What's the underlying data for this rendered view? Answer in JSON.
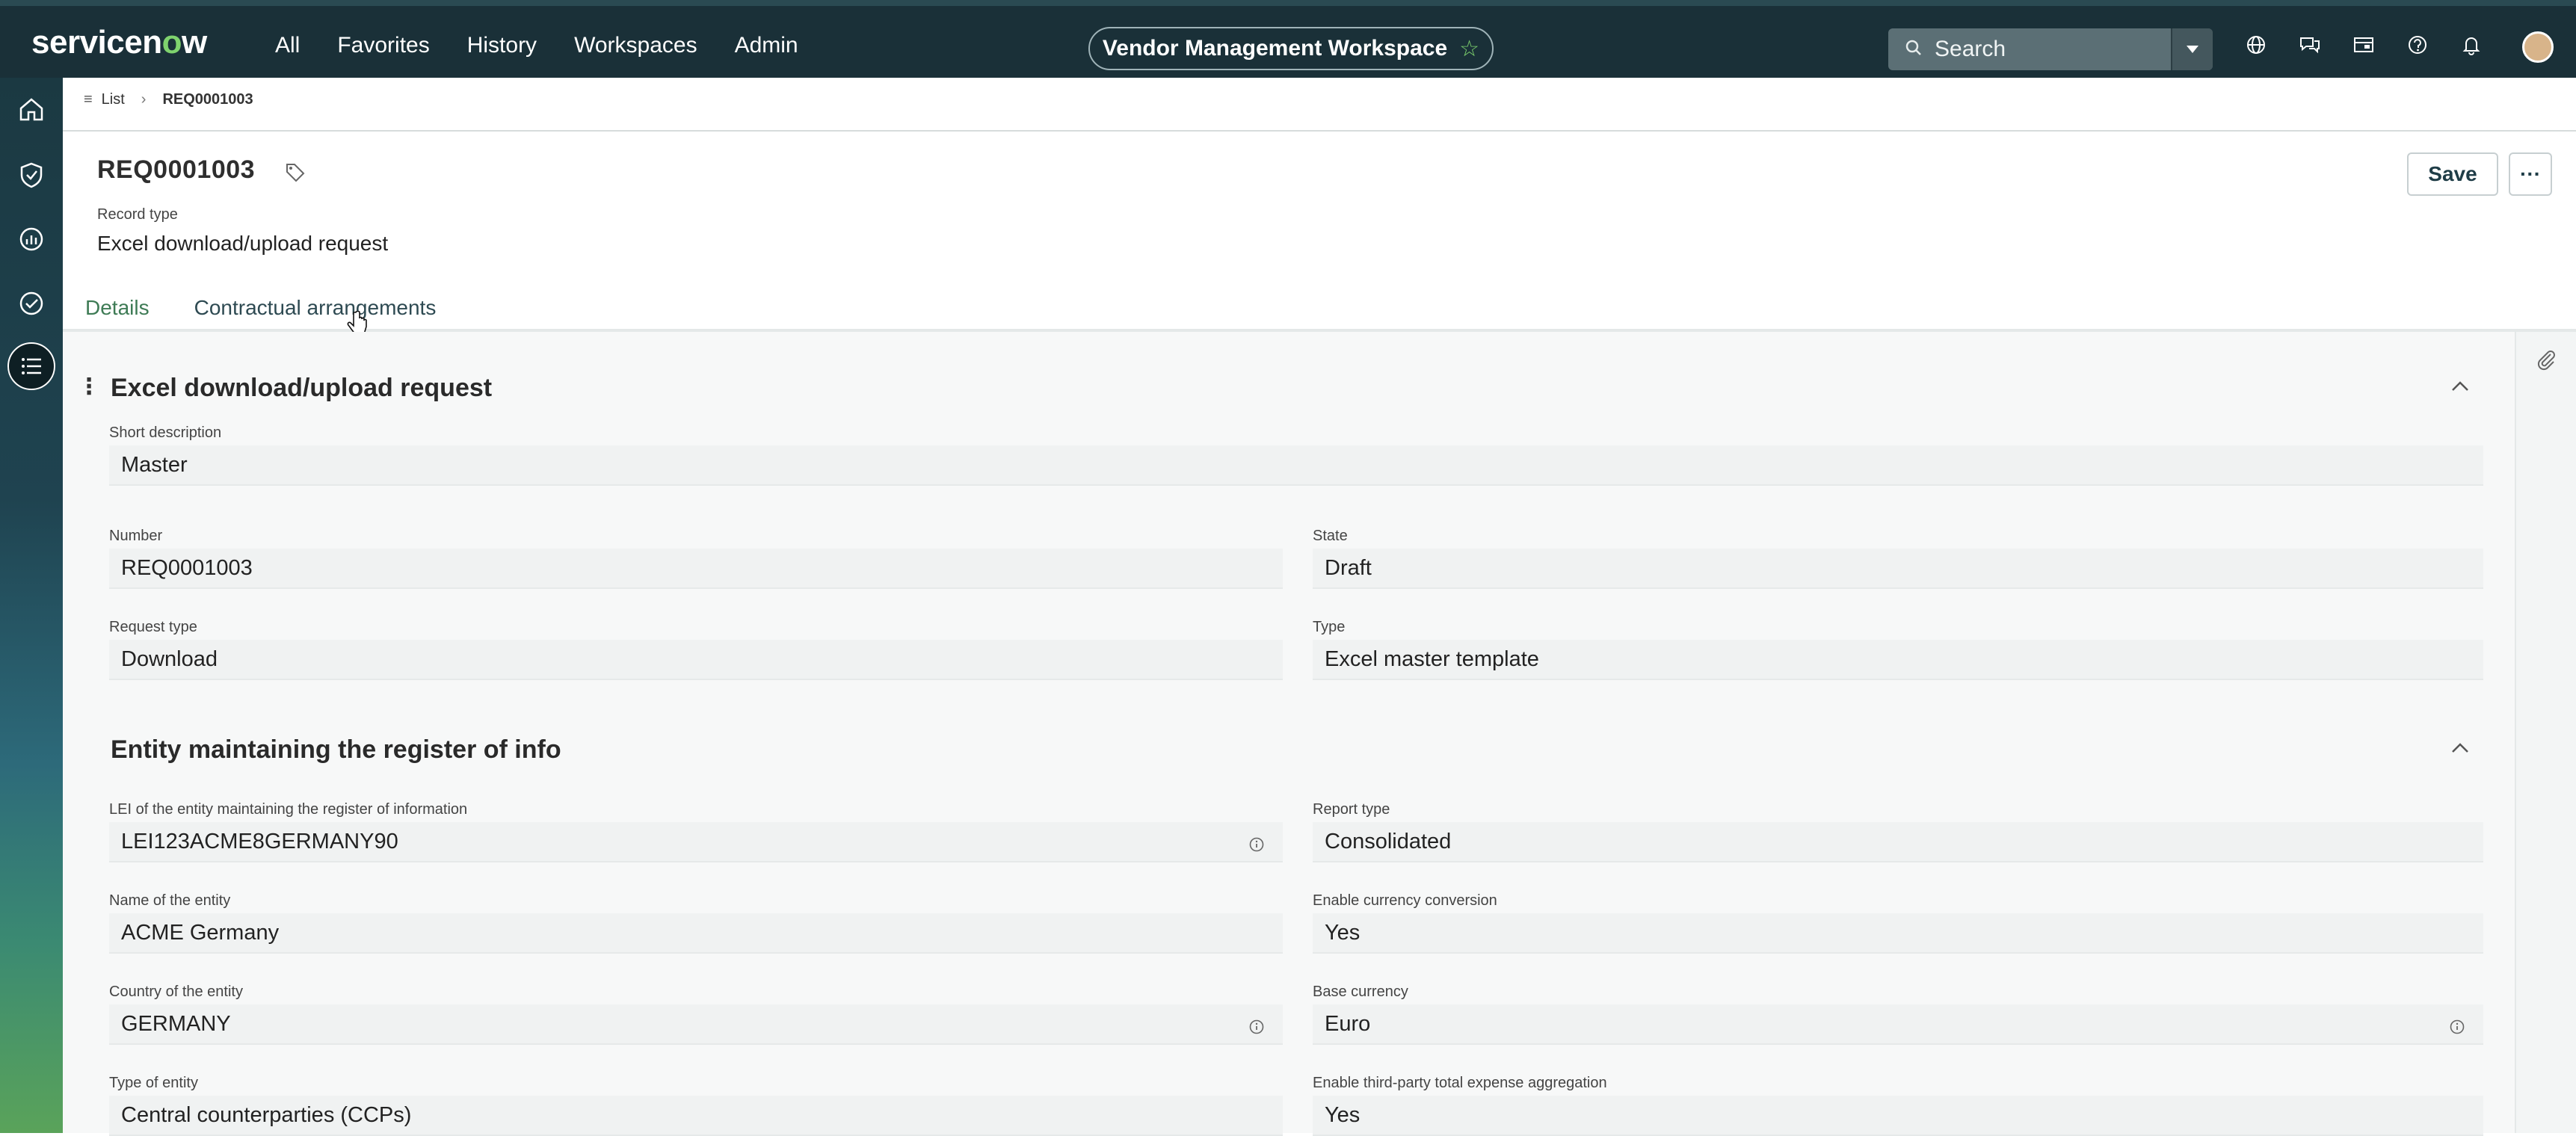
{
  "header": {
    "logo_text_1": "servicen",
    "logo_text_o": "o",
    "logo_text_2": "w",
    "nav": [
      "All",
      "Favorites",
      "History",
      "Workspaces",
      "Admin"
    ],
    "workspace": "Vendor Management Workspace",
    "search_placeholder": "Search"
  },
  "breadcrumb": {
    "list_label": "List",
    "current": "REQ0001003"
  },
  "record": {
    "title": "REQ0001003",
    "record_type_label": "Record type",
    "record_type_value": "Excel download/upload request",
    "save_label": "Save",
    "more_label": "···"
  },
  "tabs": [
    {
      "label": "Details",
      "active": true
    },
    {
      "label": "Contractual arrangements",
      "active": false
    }
  ],
  "section1": {
    "title": "Excel download/upload request",
    "short_description": {
      "label": "Short description",
      "value": "Master"
    },
    "number": {
      "label": "Number",
      "value": "REQ0001003"
    },
    "state": {
      "label": "State",
      "value": "Draft"
    },
    "request_type": {
      "label": "Request type",
      "value": "Download"
    },
    "type": {
      "label": "Type",
      "value": "Excel master template"
    }
  },
  "section2": {
    "title": "Entity maintaining the register of info",
    "lei": {
      "label": "LEI of the entity maintaining the register of information",
      "value": "LEI123ACME8GERMANY90"
    },
    "report_type": {
      "label": "Report type",
      "value": "Consolidated"
    },
    "entity_name": {
      "label": "Name of the entity",
      "value": "ACME Germany"
    },
    "currency_conversion": {
      "label": "Enable currency conversion",
      "value": "Yes"
    },
    "country": {
      "label": "Country of the entity",
      "value": "GERMANY"
    },
    "base_currency": {
      "label": "Base currency",
      "value": "Euro"
    },
    "entity_type": {
      "label": "Type of entity",
      "value": "Central counterparties (CCPs)"
    },
    "expense_aggregation": {
      "label": "Enable third-party total expense aggregation",
      "value": "Yes"
    }
  },
  "colors": {
    "topbar": "#1a3038",
    "accent_green": "#3e7b55",
    "logo_o": "#7fd36e"
  },
  "icons": {
    "sidebar": [
      "home-icon",
      "shield-icon",
      "analytics-icon",
      "check-circle-icon",
      "list-icon"
    ],
    "top": [
      "globe-icon",
      "chat-icon",
      "inbox-icon",
      "help-icon",
      "bell-icon"
    ]
  }
}
